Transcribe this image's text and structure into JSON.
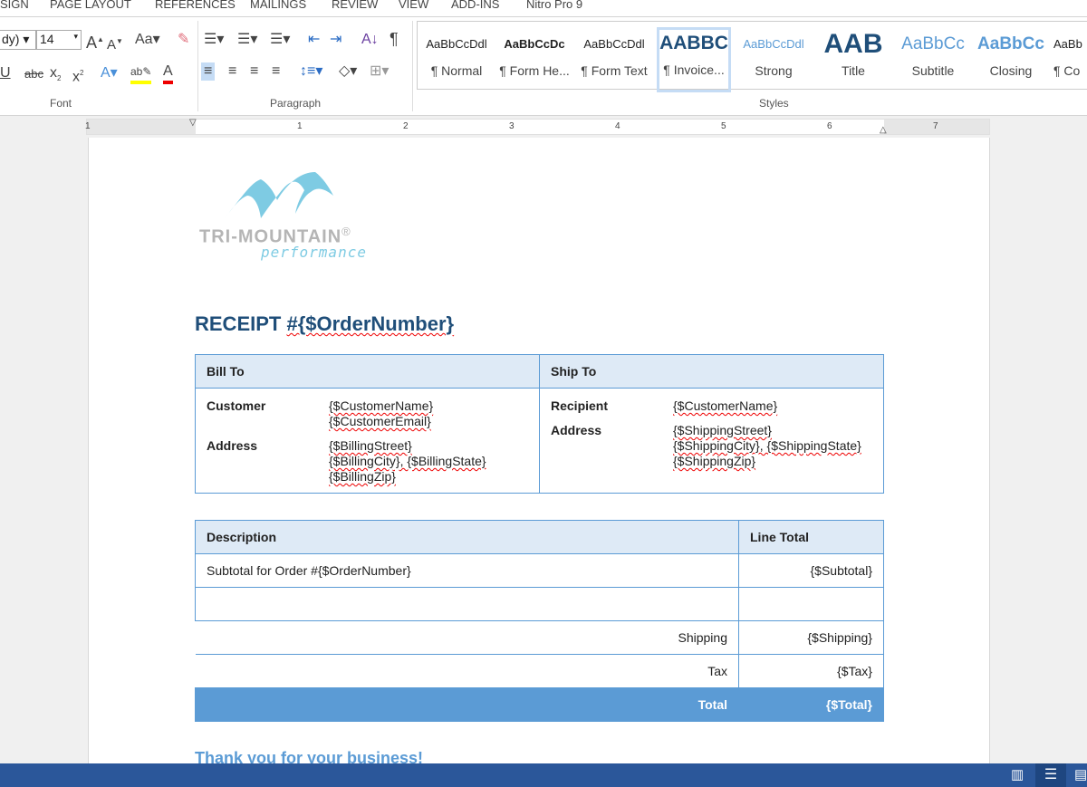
{
  "ribbon_tabs": [
    "SIGN",
    "PAGE LAYOUT",
    "REFERENCES",
    "MAILINGS",
    "REVIEW",
    "VIEW",
    "ADD-INS",
    "Nitro Pro 9"
  ],
  "font": {
    "name": "dy)",
    "size": "14",
    "group_label": "Font"
  },
  "paragraph": {
    "group_label": "Paragraph"
  },
  "styles": {
    "group_label": "Styles",
    "items": [
      {
        "preview": "AaBbCcDdl",
        "name": "¶ Normal"
      },
      {
        "preview": "AaBbCcDc",
        "name": "¶ Form He..."
      },
      {
        "preview": "AaBbCcDdl",
        "name": "¶ Form Text"
      },
      {
        "preview": "AABBC",
        "name": "¶ Invoice..."
      },
      {
        "preview": "AaBbCcDdl",
        "name": "Strong"
      },
      {
        "preview": "AAB",
        "name": "Title"
      },
      {
        "preview": "AaBbCc",
        "name": "Subtitle"
      },
      {
        "preview": "AaBbCc",
        "name": "Closing"
      },
      {
        "preview": "AaBb",
        "name": "¶ Co"
      }
    ],
    "selected": "¶ Invoice..."
  },
  "ruler": {
    "numbers": [
      "1",
      "1",
      "2",
      "3",
      "4",
      "5",
      "6",
      "7"
    ]
  },
  "logo": {
    "brand": "TRI-MOUNTAIN",
    "reg": "®",
    "tagline": "performance"
  },
  "document": {
    "title_prefix": "RECEIPT ",
    "title_field": "#{$OrderNumber}",
    "bill_to": {
      "header": "Bill To",
      "customer_label": "Customer",
      "customer_name": "{$CustomerName}",
      "customer_email": "{$CustomerEmail}",
      "address_label": "Address",
      "street": "{$BillingStreet}",
      "city_state": "{$BillingCity}, {$BillingState}",
      "zip": "{$BillingZip}"
    },
    "ship_to": {
      "header": "Ship To",
      "recipient_label": "Recipient",
      "recipient": "{$CustomerName}",
      "address_label": "Address",
      "street": "{$ShippingStreet}",
      "city_state": "{$ShippingCity}, {$ShippingState}",
      "zip": "{$ShippingZip}"
    },
    "items": {
      "col_description": "Description",
      "col_total": "Line Total",
      "subtotal_desc": "Subtotal for Order #{$OrderNumber}",
      "subtotal": "{$Subtotal}",
      "shipping_label": "Shipping",
      "shipping": "{$Shipping}",
      "tax_label": "Tax",
      "tax": "{$Tax}",
      "total_label": "Total",
      "total": "{$Total}"
    },
    "closing": "Thank you for your business!"
  },
  "colors": {
    "accent": "#5b9bd5",
    "title": "#1f4e79",
    "status_bar": "#2b579a",
    "logo_blue": "#7ecbe3",
    "logo_gray": "#b5b5b5"
  }
}
